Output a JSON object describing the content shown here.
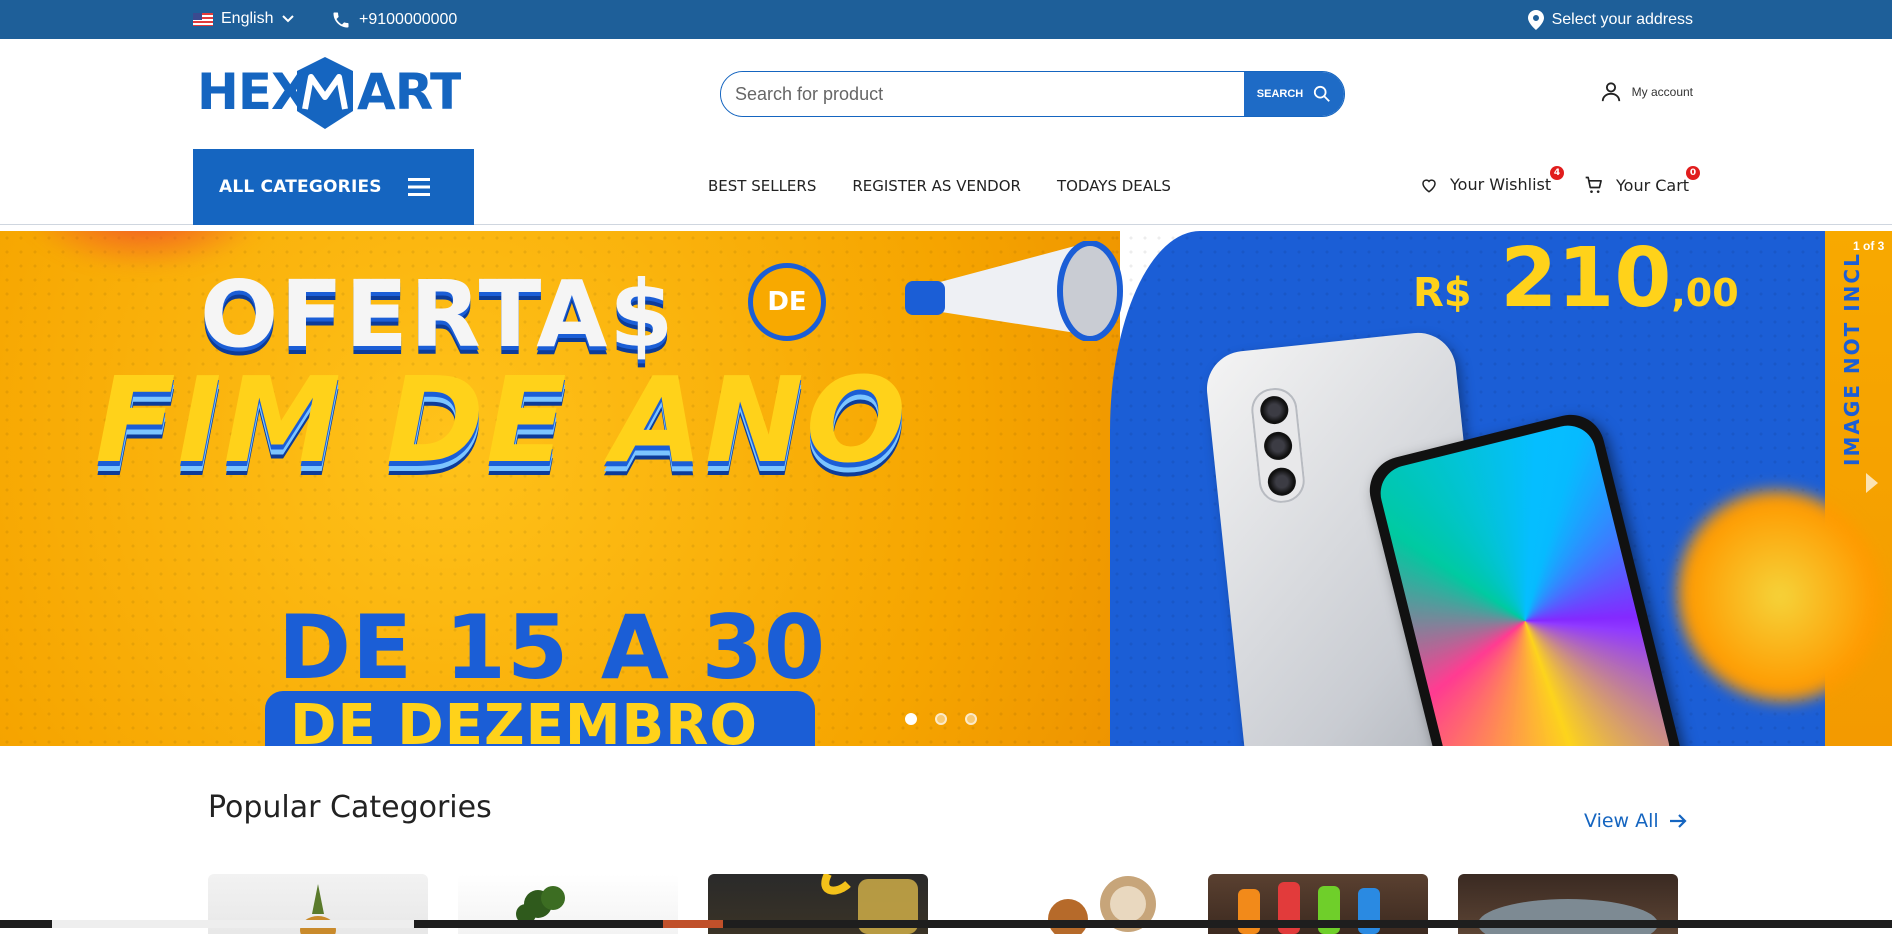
{
  "topbar": {
    "language": "English",
    "phone": "+9100000000",
    "address": "Select your address"
  },
  "header": {
    "logo_text": "HEXMART",
    "search_placeholder": "Search for product",
    "search_button": "SEARCH",
    "account_label": "My account"
  },
  "nav": {
    "all_categories": "ALL CATEGORIES",
    "menu": [
      "BEST SELLERS",
      "REGISTER AS VENDOR",
      "TODAYS DEALS"
    ],
    "wishlist_label": "Your Wishlist",
    "wishlist_count": "4",
    "cart_label": "Your Cart",
    "cart_count": "0"
  },
  "banner": {
    "line1": "OFERTA$",
    "badge": "DE",
    "line2": "FIM DE ANO",
    "dates": "DE 15 A 30",
    "month": "DE DEZEMBRO",
    "price_currency": "R$",
    "price_value": "210",
    "price_cents": ",00",
    "side_note": "IMAGE NOT INCL",
    "counter": "1 of 3",
    "slides": 3,
    "active_slide": 1
  },
  "popular": {
    "title": "Popular Categories",
    "view_all": "View All"
  },
  "colors": {
    "brand_blue": "#1565c0",
    "topbar": "#1e5f99",
    "badge_red": "#e11d1d"
  }
}
